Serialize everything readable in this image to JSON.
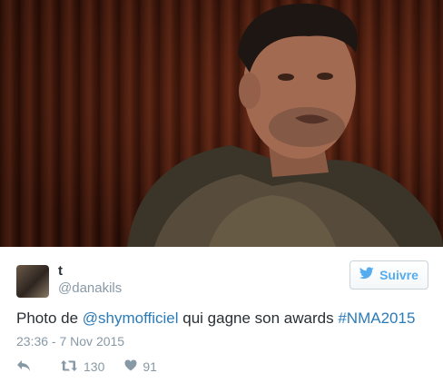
{
  "tweet": {
    "author": {
      "display_name": "t",
      "handle": "@danakils"
    },
    "follow_button": {
      "label": "Suivre",
      "icon": "twitter-bird-icon"
    },
    "text": {
      "prefix": "Photo de ",
      "mention": "@shymofficiel",
      "middle": " qui gagne son awards ",
      "hashtag": "#NMA2015"
    },
    "timestamp": "23:36 - 7 Nov 2015",
    "actions": {
      "reply_icon": "reply-icon",
      "retweet_icon": "retweet-icon",
      "retweet_count": "130",
      "like_icon": "heart-icon",
      "like_count": "91"
    },
    "colors": {
      "link": "#2b7bb9",
      "brand": "#55acee",
      "muted": "#8899a6",
      "text": "#292f33"
    }
  }
}
